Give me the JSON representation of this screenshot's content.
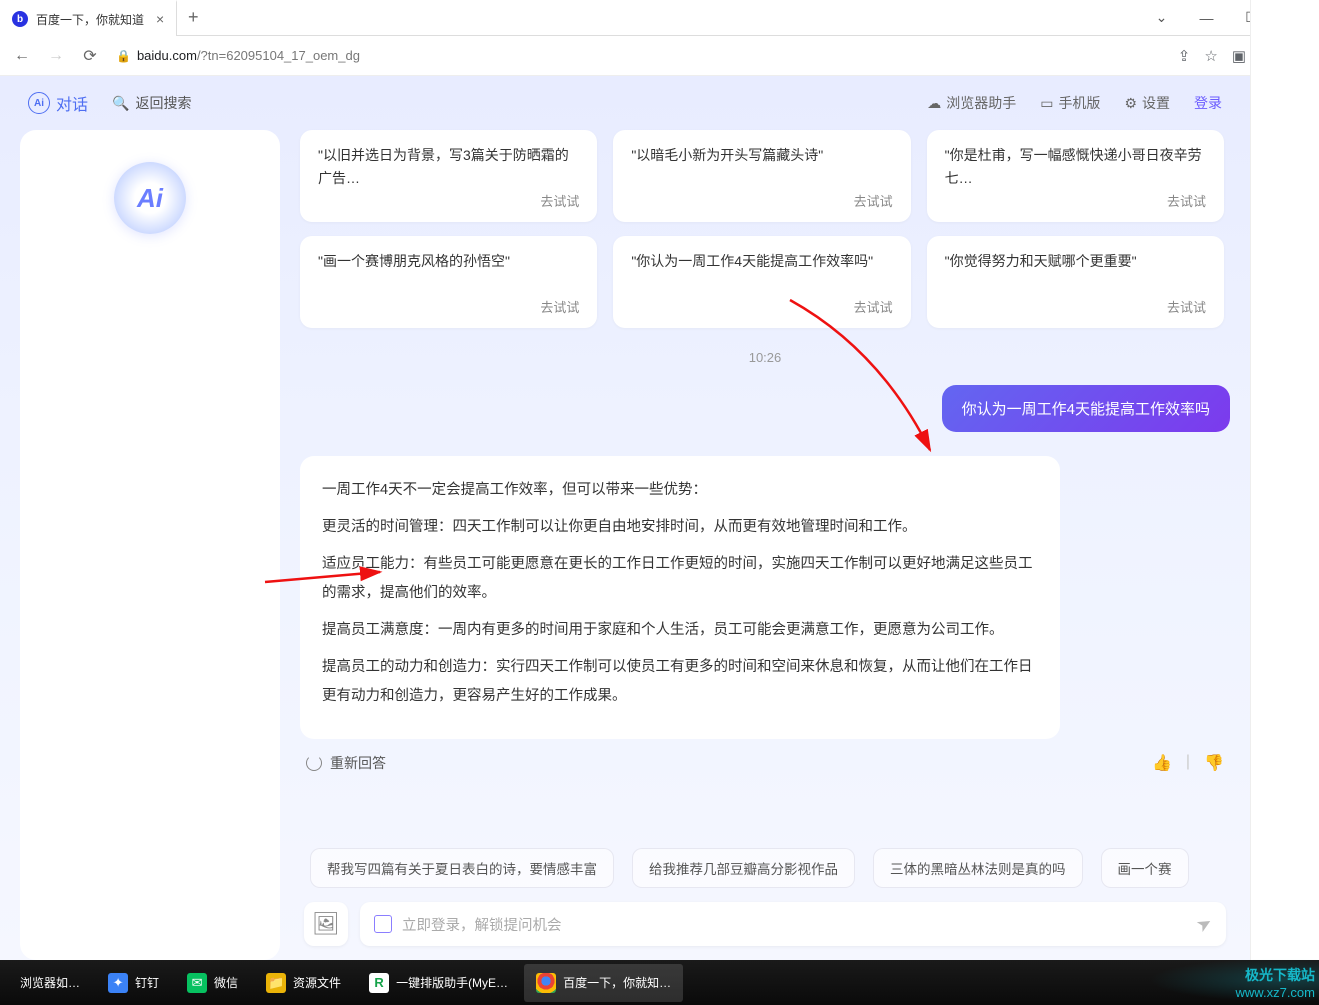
{
  "browser": {
    "tab_title": "百度一下，你就知道",
    "url_host": "baidu.com",
    "url_path": "/?tn=62095104_17_oem_dg"
  },
  "topbar": {
    "ai_label": "对话",
    "back_search": "返回搜索",
    "helper": "浏览器助手",
    "mobile": "手机版",
    "settings": "设置",
    "login": "登录"
  },
  "cards_row1": [
    {
      "text": "\"以旧并选日为背景，写3篇关于防晒霜的广告…",
      "try": "去试试"
    },
    {
      "text": "\"以暗毛小新为开头写篇藏头诗\"",
      "try": "去试试"
    },
    {
      "text": "\"你是杜甫，写一幅感慨快递小哥日夜辛劳七…",
      "try": "去试试"
    }
  ],
  "cards_row2": [
    {
      "text": "\"画一个赛博朋克风格的孙悟空\"",
      "try": "去试试"
    },
    {
      "text": "\"你认为一周工作4天能提高工作效率吗\"",
      "try": "去试试"
    },
    {
      "text": "\"你觉得努力和天赋哪个更重要\"",
      "try": "去试试"
    }
  ],
  "timestamp": "10:26",
  "user_message": "你认为一周工作4天能提高工作效率吗",
  "ai_response": {
    "p1": "一周工作4天不一定会提高工作效率，但可以带来一些优势：",
    "p2": "更灵活的时间管理：四天工作制可以让你更自由地安排时间，从而更有效地管理时间和工作。",
    "p3": "适应员工能力：有些员工可能更愿意在更长的工作日工作更短的时间，实施四天工作制可以更好地满足这些员工的需求，提高他们的效率。",
    "p4": "提高员工满意度：一周内有更多的时间用于家庭和个人生活，员工可能会更满意工作，更愿意为公司工作。",
    "p5": "提高员工的动力和创造力：实行四天工作制可以使员工有更多的时间和空间来休息和恢复，从而让他们在工作日更有动力和创造力，更容易产生好的工作成果。"
  },
  "regenerate": "重新回答",
  "suggestions": [
    "帮我写四篇有关于夏日表白的诗，要情感丰富",
    "给我推荐几部豆瓣高分影视作品",
    "三体的黑暗丛林法则是真的吗",
    "画一个赛"
  ],
  "input_placeholder": "立即登录，解锁提问机会",
  "taskbar": [
    {
      "label": "浏览器如…",
      "icon": ""
    },
    {
      "label": "钉钉",
      "icon": "ding"
    },
    {
      "label": "微信",
      "icon": "wx"
    },
    {
      "label": "资源文件",
      "icon": "folder"
    },
    {
      "label": "一键排版助手(MyE…",
      "icon": "r"
    },
    {
      "label": "百度一下，你就知…",
      "icon": "chrome"
    }
  ],
  "watermark": {
    "line1": "极光下载站",
    "line2": "www.xz7.com"
  }
}
